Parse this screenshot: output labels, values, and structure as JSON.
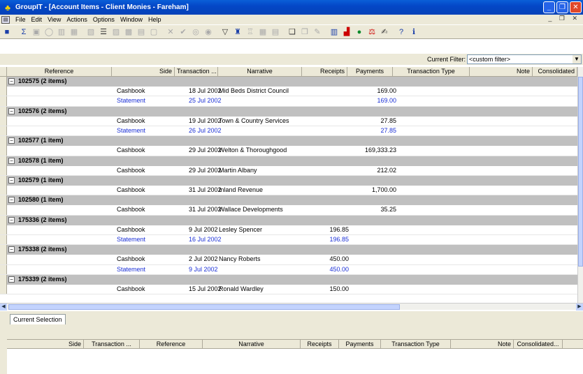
{
  "window": {
    "title": "GroupIT - [Account Items - Client Monies - Fareham]",
    "minimize": "_",
    "maximize": "❐",
    "close": "✕"
  },
  "menu": [
    "File",
    "Edit",
    "View",
    "Actions",
    "Options",
    "Window",
    "Help"
  ],
  "mdi_buttons": "_ ❐ ✕",
  "filter": {
    "label": "Current Filter:",
    "value": "<custom filter>"
  },
  "columns": [
    "Reference",
    "Side",
    "Transaction ...",
    "Narrative",
    "Receipts",
    "Payments",
    "Transaction Type",
    "Note",
    "Consolidated"
  ],
  "groups": [
    {
      "label": "102575  (2 items)",
      "items": [
        {
          "side": "Cashbook",
          "date": "18 Jul 2002",
          "narrative": "Mid Beds District Council",
          "receipts": "",
          "payments": "169.00",
          "statement": false
        },
        {
          "side": "Statement",
          "date": "25 Jul 2002",
          "narrative": "",
          "receipts": "",
          "payments": "169.00",
          "statement": true
        }
      ]
    },
    {
      "label": "102576  (2 items)",
      "items": [
        {
          "side": "Cashbook",
          "date": "19 Jul 2002",
          "narrative": "Town & Country Services",
          "receipts": "",
          "payments": "27.85",
          "statement": false
        },
        {
          "side": "Statement",
          "date": "26 Jul 2002",
          "narrative": "",
          "receipts": "",
          "payments": "27.85",
          "statement": true
        }
      ]
    },
    {
      "label": "102577  (1 item)",
      "items": [
        {
          "side": "Cashbook",
          "date": "29 Jul 2002",
          "narrative": "Welton & Thoroughgood",
          "receipts": "",
          "payments": "169,333.23",
          "statement": false
        }
      ]
    },
    {
      "label": "102578  (1 item)",
      "items": [
        {
          "side": "Cashbook",
          "date": "29 Jul 2002",
          "narrative": "Martin Albany",
          "receipts": "",
          "payments": "212.02",
          "statement": false
        }
      ]
    },
    {
      "label": "102579  (1 item)",
      "items": [
        {
          "side": "Cashbook",
          "date": "31 Jul 2002",
          "narrative": "Inland Revenue",
          "receipts": "",
          "payments": "1,700.00",
          "statement": false
        }
      ]
    },
    {
      "label": "102580  (1 item)",
      "items": [
        {
          "side": "Cashbook",
          "date": "31 Jul 2002",
          "narrative": "Wallace Developments",
          "receipts": "",
          "payments": "35.25",
          "statement": false
        }
      ]
    },
    {
      "label": "175336  (2 items)",
      "items": [
        {
          "side": "Cashbook",
          "date": "9 Jul 2002",
          "narrative": "Lesley Spencer",
          "receipts": "196.85",
          "payments": "",
          "statement": false
        },
        {
          "side": "Statement",
          "date": "16 Jul 2002",
          "narrative": "",
          "receipts": "196.85",
          "payments": "",
          "statement": true
        }
      ]
    },
    {
      "label": "175338  (2 items)",
      "items": [
        {
          "side": "Cashbook",
          "date": "2 Jul 2002",
          "narrative": "Nancy Roberts",
          "receipts": "450.00",
          "payments": "",
          "statement": false
        },
        {
          "side": "Statement",
          "date": "9 Jul 2002",
          "narrative": "",
          "receipts": "450.00",
          "payments": "",
          "statement": true
        }
      ]
    },
    {
      "label": "175339  (2 items)",
      "items": [
        {
          "side": "Cashbook",
          "date": "15 Jul 2002",
          "narrative": "Ronald Wardley",
          "receipts": "150.00",
          "payments": "",
          "statement": false
        }
      ]
    }
  ],
  "lower": {
    "tab": "Current Selection",
    "columns": [
      "Side",
      "Transaction ...",
      "Reference",
      "Narrative",
      "Receipts",
      "Payments",
      "Transaction Type",
      "Note",
      "Consolidated..."
    ]
  }
}
